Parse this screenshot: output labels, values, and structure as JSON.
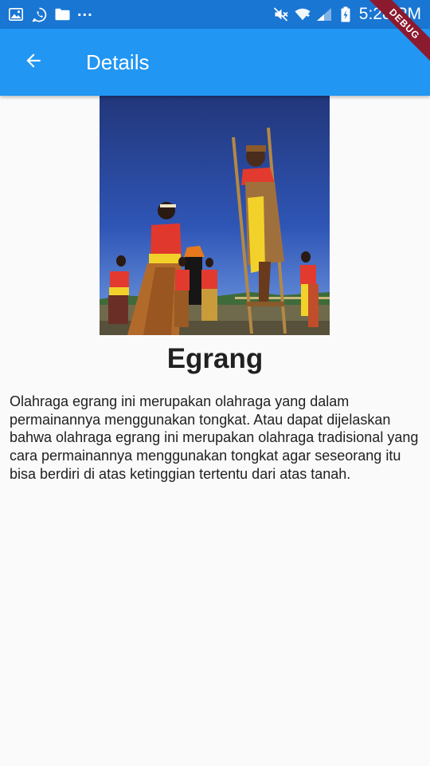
{
  "status_bar": {
    "time": "5:28 PM",
    "icons": [
      "image-icon",
      "whatsapp-icon",
      "folder-icon",
      "mute-icon",
      "wifi-icon",
      "signal-icon",
      "battery-charging-icon"
    ],
    "overflow": "..."
  },
  "debug_banner": {
    "label": "DEBUG"
  },
  "app_bar": {
    "title": "Details",
    "back_icon": "arrow-back-icon"
  },
  "detail": {
    "title": "Egrang",
    "description": "Olahraga egrang ini merupakan olahraga yang dalam permainannya menggunakan tongkat. Atau dapat dijelaskan bahwa olahraga egrang ini merupakan olahraga tradisional yang cara permainannya menggunakan tongkat agar seseorang itu bisa berdiri di atas ketinggian tertentu dari atas tanah."
  },
  "colors": {
    "status_bar": "#1976d2",
    "app_bar": "#2196f3",
    "background": "#fafafa",
    "text": "#212121",
    "debug_ribbon": "#8b1a2f"
  }
}
